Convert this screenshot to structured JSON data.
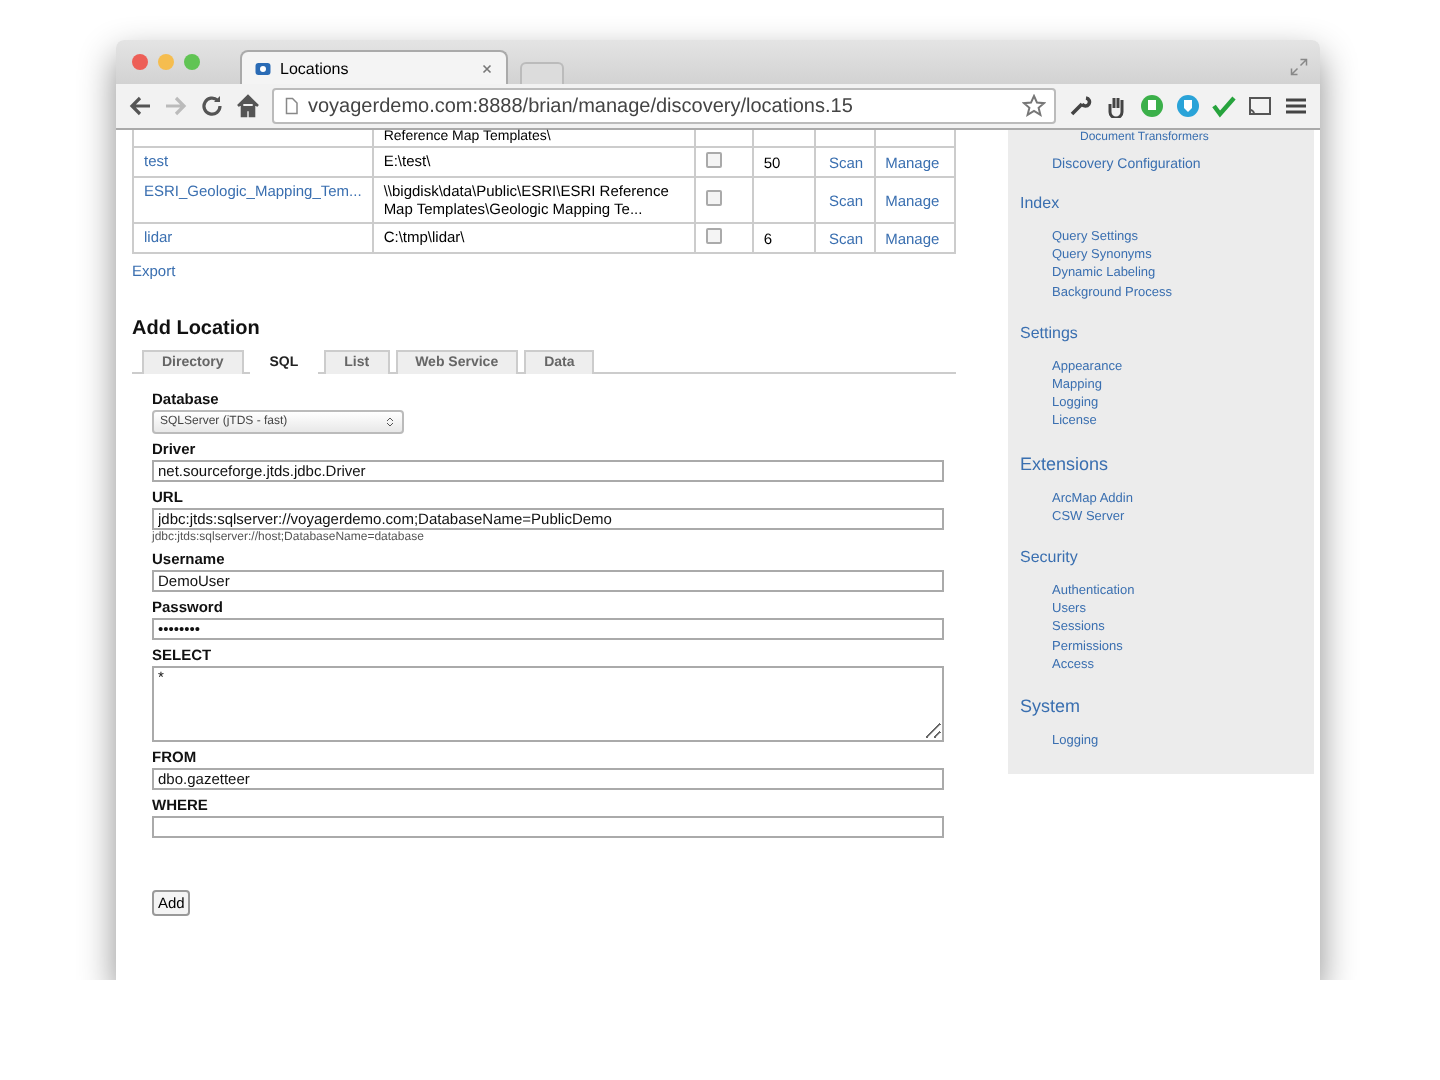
{
  "browser": {
    "tab_title": "Locations",
    "url": "voyagerdemo.com:8888/brian/manage/discovery/locations.15",
    "forward_disabled": true
  },
  "locations": {
    "rows": [
      {
        "kind": "continued",
        "path": "Reference Map Templates\\"
      },
      {
        "name": "test",
        "path": "E:\\test\\",
        "checked": false,
        "count": "50",
        "scan": "Scan",
        "manage": "Manage"
      },
      {
        "name": "ESRI_Geologic_Mapping_Tem...",
        "path": "\\\\bigdisk\\data\\Public\\ESRI\\ESRI Reference Map Templates\\Geologic Mapping Te...",
        "checked": false,
        "scan": "Scan",
        "manage": "Manage"
      },
      {
        "name": "lidar",
        "path": "C:\\tmp\\lidar\\",
        "checked": false,
        "count": "6",
        "scan": "Scan",
        "manage": "Manage"
      }
    ],
    "export": "Export"
  },
  "add_location": {
    "title": "Add Location",
    "tabs": [
      {
        "label": "Directory",
        "selected": false
      },
      {
        "label": "SQL",
        "selected": true
      },
      {
        "label": "List",
        "selected": false
      },
      {
        "label": "Web Service",
        "selected": false
      },
      {
        "label": "Data",
        "selected": false
      }
    ],
    "fields": [
      {
        "kind": "select",
        "label": "Database",
        "value": "SQLServer (jTDS - fast)"
      },
      {
        "kind": "text",
        "label": "Driver",
        "value": "net.sourceforge.jtds.jdbc.Driver"
      },
      {
        "kind": "text",
        "label": "URL",
        "value": "jdbc:jtds:sqlserver://voyagerdemo.com;DatabaseName=PublicDemo",
        "hint": "jdbc:jtds:sqlserver://host;DatabaseName=database"
      },
      {
        "kind": "text",
        "label": "Username",
        "value": "DemoUser"
      },
      {
        "kind": "text",
        "label": "Password",
        "value": "••••••••"
      },
      {
        "kind": "textarea",
        "label": "SELECT",
        "value": "*"
      },
      {
        "kind": "text",
        "label": "FROM",
        "value": "dbo.gazetteer"
      },
      {
        "kind": "text",
        "label": "WHERE"
      }
    ],
    "submit": "Add"
  },
  "sidebar": {
    "top_subitems": [
      "Document Transformers"
    ],
    "top_items": [
      "Discovery Configuration"
    ],
    "sections": [
      {
        "heading": "Index",
        "items": [
          "Query Settings",
          "Query Synonyms",
          "Dynamic Labeling",
          "Background Process"
        ]
      },
      {
        "heading": "Settings",
        "items": [
          "Appearance",
          "Mapping",
          "Logging",
          "License"
        ]
      },
      {
        "heading": "Extensions",
        "items": [
          "ArcMap Addin",
          "CSW Server"
        ]
      },
      {
        "heading": "Security",
        "items": [
          "Authentication",
          "Users",
          "Sessions",
          "Permissions",
          "Access"
        ]
      },
      {
        "heading": "System",
        "items": [
          "Logging"
        ]
      }
    ]
  }
}
